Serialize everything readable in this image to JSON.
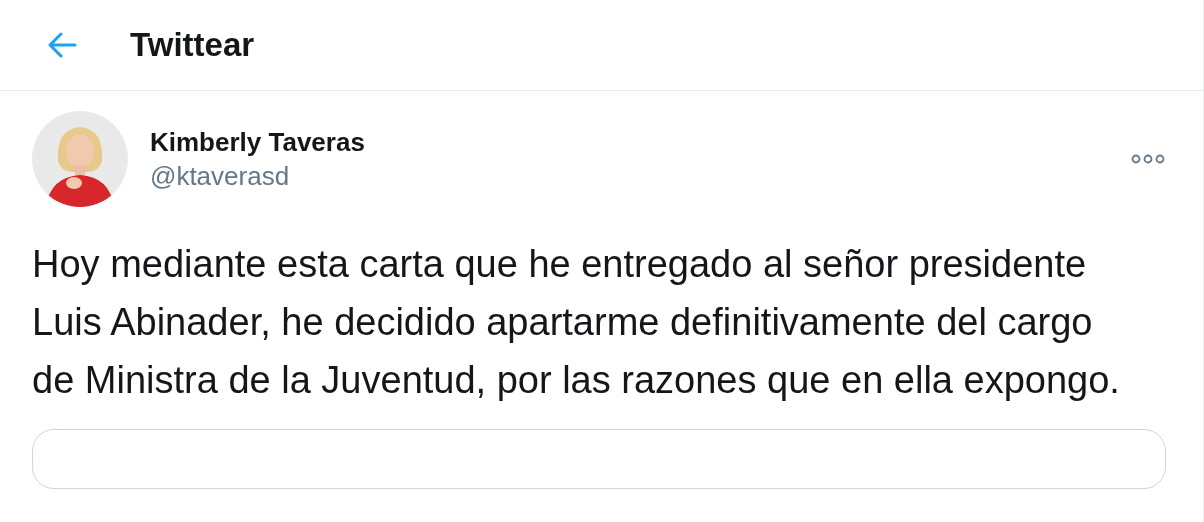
{
  "header": {
    "title": "Twittear"
  },
  "tweet": {
    "author": {
      "name": "Kimberly Taveras",
      "handle": "@ktaverasd"
    },
    "text": "Hoy mediante esta carta que he entregado al señor presidente Luis Abinader, he decidido apartarme definitivamente del cargo de Ministra de la Juventud, por las razones que en ella expongo.",
    "attachment": {
      "kind": "card"
    }
  }
}
